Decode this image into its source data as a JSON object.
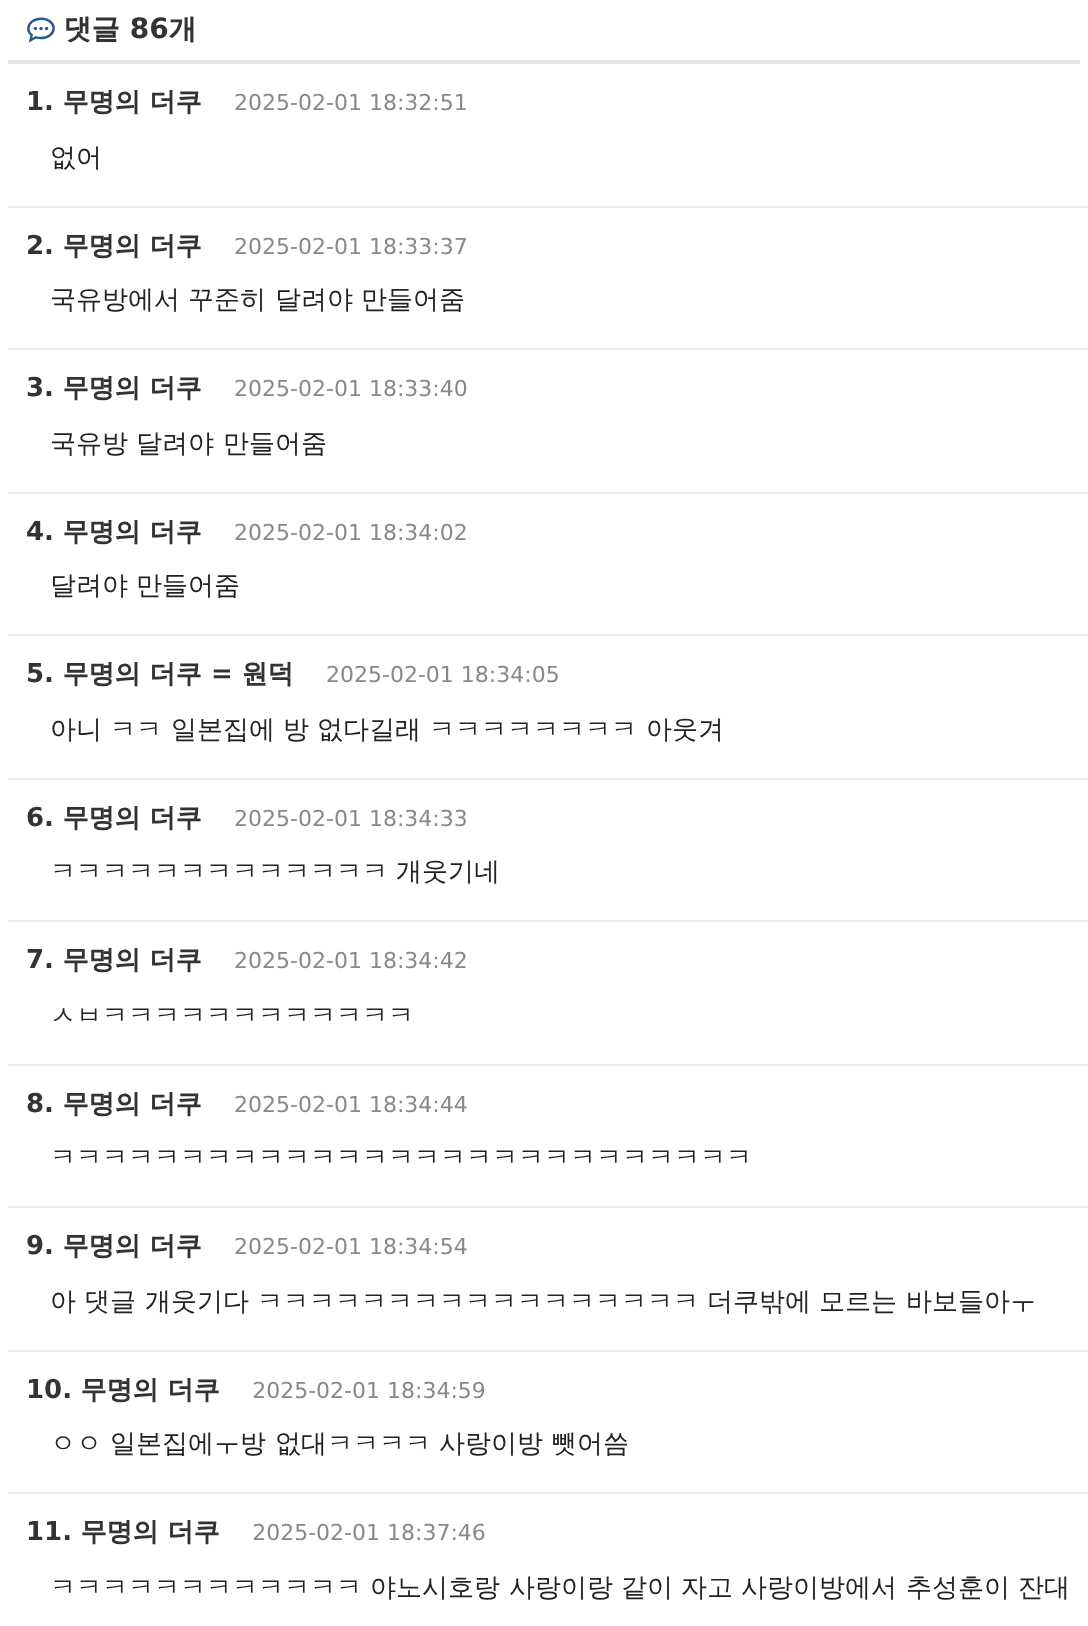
{
  "header": {
    "title": "댓글 86개"
  },
  "comments": [
    {
      "number": "1.",
      "author": "무명의 더쿠",
      "time": "2025-02-01 18:32:51",
      "text": "없어"
    },
    {
      "number": "2.",
      "author": "무명의 더쿠",
      "time": "2025-02-01 18:33:37",
      "text": "국유방에서 꾸준히 달려야 만들어줌"
    },
    {
      "number": "3.",
      "author": "무명의 더쿠",
      "time": "2025-02-01 18:33:40",
      "text": "국유방 달려야 만들어줌"
    },
    {
      "number": "4.",
      "author": "무명의 더쿠",
      "time": "2025-02-01 18:34:02",
      "text": "달려야 만들어줌"
    },
    {
      "number": "5.",
      "author": "무명의 더쿠 = 원덕",
      "time": "2025-02-01 18:34:05",
      "text": "아니 ㅋㅋ 일본집에 방 없다길래 ㅋㅋㅋㅋㅋㅋㅋㅋ 아웃겨"
    },
    {
      "number": "6.",
      "author": "무명의 더쿠",
      "time": "2025-02-01 18:34:33",
      "text": "ㅋㅋㅋㅋㅋㅋㅋㅋㅋㅋㅋㅋㅋ 개웃기네"
    },
    {
      "number": "7.",
      "author": "무명의 더쿠",
      "time": "2025-02-01 18:34:42",
      "text": "ㅅㅂㅋㅋㅋㅋㅋㅋㅋㅋㅋㅋㅋㅋ"
    },
    {
      "number": "8.",
      "author": "무명의 더쿠",
      "time": "2025-02-01 18:34:44",
      "text": "ㅋㅋㅋㅋㅋㅋㅋㅋㅋㅋㅋㅋㅋㅋㅋㅋㅋㅋㅋㅋㅋㅋㅋㅋㅋㅋㅋ"
    },
    {
      "number": "9.",
      "author": "무명의 더쿠",
      "time": "2025-02-01 18:34:54",
      "text": "아 댓글 개웃기다 ㅋㅋㅋㅋㅋㅋㅋㅋㅋㅋㅋㅋㅋㅋㅋㅋㅋ 더쿠밖에 모르는 바보들아ㅜ"
    },
    {
      "number": "10.",
      "author": "무명의 더쿠",
      "time": "2025-02-01 18:34:59",
      "text": "ㅇㅇ 일본집에ㅜ방 없대ㅋㅋㅋㅋ 사랑이방 뺏어씀"
    },
    {
      "number": "11.",
      "author": "무명의 더쿠",
      "time": "2025-02-01 18:37:46",
      "text": "ㅋㅋㅋㅋㅋㅋㅋㅋㅋㅋㅋㅋ 야노시호랑 사랑이랑 같이 자고 사랑이방에서 추성훈이 잔대"
    }
  ]
}
